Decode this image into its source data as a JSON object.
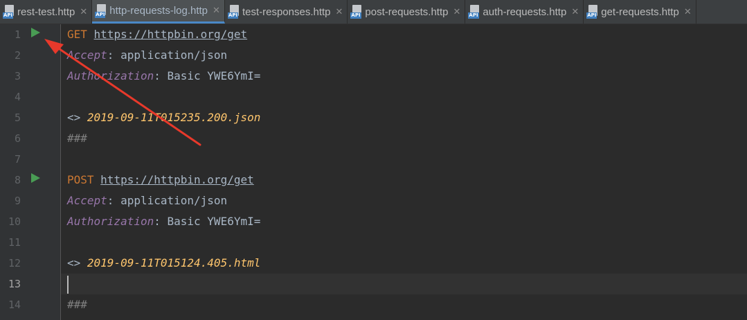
{
  "tabs": [
    {
      "icon": "api-file-icon",
      "badge": "API",
      "label": "rest-test.http",
      "active": false
    },
    {
      "icon": "api-file-icon",
      "badge": "API",
      "label": "http-requests-log.http",
      "active": true
    },
    {
      "icon": "api-file-icon",
      "badge": "API",
      "label": "test-responses.http",
      "active": false
    },
    {
      "icon": "api-file-icon",
      "badge": "API",
      "label": "post-requests.http",
      "active": false
    },
    {
      "icon": "api-file-icon",
      "badge": "API",
      "label": "auth-requests.http",
      "active": false
    },
    {
      "icon": "api-file-icon",
      "badge": "API",
      "label": "get-requests.http",
      "active": false
    }
  ],
  "close_glyph": "✕",
  "line_numbers": [
    "1",
    "2",
    "3",
    "4",
    "5",
    "6",
    "7",
    "8",
    "9",
    "10",
    "11",
    "12",
    "13",
    "14"
  ],
  "current_line": 13,
  "run_icons": [
    "run-request-icon",
    "run-request-icon"
  ],
  "code": {
    "l1_method": "GET",
    "l1_url": "https://httpbin.org/get",
    "l2_name": "Accept",
    "l2_value": ": application/json",
    "l3_name": "Authorization",
    "l3_value": ": Basic YWE6YmI=",
    "l5_marker": "<>",
    "l5_path": "2019-09-11T015235.200.json",
    "l6_sep": "###",
    "l8_method": "POST",
    "l8_url": "https://httpbin.org/get",
    "l9_name": "Accept",
    "l9_value": ": application/json",
    "l10_name": "Authorization",
    "l10_value": ": Basic YWE6YmI=",
    "l12_marker": "<>",
    "l12_path": "2019-09-11T015124.405.html",
    "l14_sep": "###"
  },
  "annotation": {
    "color": "#e8392b"
  },
  "colors": {
    "keyword": "#cc7832",
    "header_name": "#9876aa",
    "file_path": "#ffc66d",
    "text": "#a9b7c6",
    "run": "#499c54",
    "accent": "#4a88c7"
  }
}
